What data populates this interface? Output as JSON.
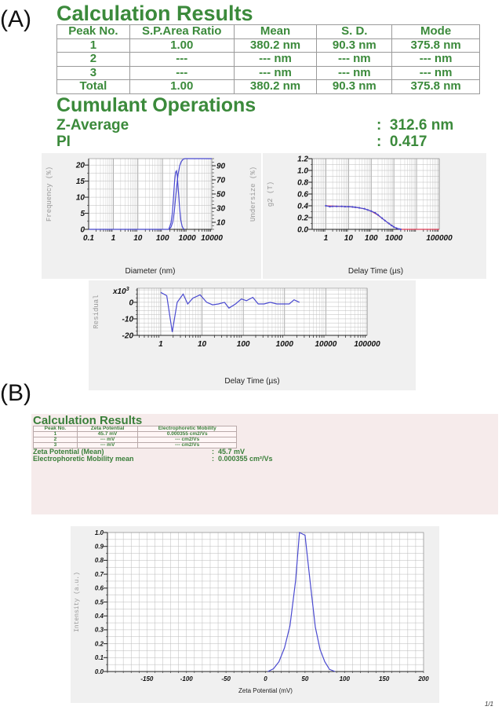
{
  "panel_a_label": "(A)",
  "panel_b_label": "(B)",
  "size_results": {
    "title": "Calculation Results",
    "headers": [
      "Peak No.",
      "S.P.Area Ratio",
      "Mean",
      "S. D.",
      "Mode"
    ],
    "rows": [
      [
        "1",
        "1.00",
        "380.2 nm",
        "90.3 nm",
        "375.8 nm"
      ],
      [
        "2",
        "---",
        "--- nm",
        "--- nm",
        "--- nm"
      ],
      [
        "3",
        "---",
        "--- nm",
        "--- nm",
        "--- nm"
      ],
      [
        "Total",
        "1.00",
        "380.2 nm",
        "90.3 nm",
        "375.8 nm"
      ]
    ],
    "cumulant_title": "Cumulant Operations",
    "z_average_label": "Z-Average",
    "z_average_value": ":  312.6 nm",
    "pi_label": "PI",
    "pi_value": ":  0.417"
  },
  "zeta_results": {
    "title": "Calculation Results",
    "headers": [
      "Peak No.",
      "Zeta Potential",
      "Electrophoretic Mobility"
    ],
    "rows": [
      [
        "1",
        "45.7 mV",
        "0.000355 cm2/Vs"
      ],
      [
        "2",
        "--- mV",
        "--- cm2/Vs"
      ],
      [
        "3",
        "--- mV",
        "--- cm2/Vs"
      ]
    ],
    "mean_label": "Zeta Potential (Mean)",
    "mean_value": ":  45.7 mV",
    "mobility_label": "Electrophoretic Mobility mean",
    "mobility_value": ":  0.000355 cm²/Vs"
  },
  "page_number": "1/1",
  "colors": {
    "green": "#3b8a3b",
    "series_blue": "#4a4ad0",
    "fit_red": "#e0405a",
    "panel_bg": "#f0f0f0",
    "pink_bg": "#f6ebeb"
  },
  "chart_data": [
    {
      "type": "line",
      "xlabel": "Diameter (nm)",
      "ylabel": "Frequency (%)",
      "y2label": "Undersize (%)",
      "xscale": "log",
      "xlim": [
        0.1,
        10000
      ],
      "ylim": [
        0,
        22
      ],
      "y2lim": [
        0,
        100
      ],
      "xticks": [
        "0.1",
        "1",
        "10",
        "100",
        "1000",
        "10000"
      ],
      "yticks": [
        "0",
        "5",
        "10",
        "15",
        "20"
      ],
      "y2ticks": [
        "10",
        "30",
        "50",
        "70",
        "90"
      ],
      "grid": true,
      "series": [
        {
          "axis": "left",
          "x": [
            180,
            220,
            250,
            280,
            310,
            340,
            370,
            400,
            440,
            490,
            550,
            620,
            700,
            800
          ],
          "y": [
            0,
            2,
            5,
            10,
            15,
            17.8,
            18.2,
            16.5,
            12,
            7,
            3,
            1,
            0.2,
            0
          ]
        },
        {
          "axis": "right",
          "x": [
            0.1,
            180,
            220,
            260,
            300,
            340,
            380,
            430,
            500,
            580,
            680,
            800,
            10000
          ],
          "y": [
            0,
            0,
            3,
            10,
            25,
            45,
            62,
            78,
            90,
            96,
            99,
            100,
            100
          ]
        }
      ]
    },
    {
      "type": "line",
      "xlabel": "Delay Time (µs)",
      "ylabel": "g2 (T)",
      "xscale": "log",
      "xlim": [
        0.25,
        100000
      ],
      "ylim": [
        0,
        1.2
      ],
      "xticks": [
        "1",
        "10",
        "100",
        "1000",
        "100000"
      ],
      "yticks": [
        "0.0",
        "0.2",
        "0.4",
        "0.6",
        "0.8",
        "1.0",
        "1.2"
      ],
      "grid": true,
      "series": [
        {
          "role": "fit",
          "x": [
            1,
            2,
            5,
            10,
            20,
            50,
            100,
            200,
            400,
            700,
            1000,
            1500,
            2000,
            5000,
            20000,
            100000
          ],
          "y": [
            0.4,
            0.395,
            0.39,
            0.385,
            0.375,
            0.35,
            0.31,
            0.24,
            0.15,
            0.08,
            0.04,
            0.01,
            0.0,
            0.0,
            0.0,
            0.0
          ]
        },
        {
          "role": "data",
          "x": [
            1,
            1.5,
            2,
            3,
            5,
            7,
            10,
            15,
            20,
            30,
            50,
            70,
            100,
            150,
            200,
            300,
            400,
            600,
            800,
            1000,
            1300,
            1700,
            2000
          ],
          "y": [
            0.4,
            0.385,
            0.39,
            0.39,
            0.39,
            0.385,
            0.385,
            0.38,
            0.375,
            0.365,
            0.35,
            0.33,
            0.31,
            0.28,
            0.245,
            0.19,
            0.15,
            0.1,
            0.065,
            0.04,
            0.02,
            0.005,
            0.0
          ]
        }
      ]
    },
    {
      "type": "line",
      "xlabel": "Delay Time (µs)",
      "ylabel": "Residual",
      "multiplier_base": "x10",
      "multiplier_exp": "3",
      "xscale": "log",
      "xlim": [
        0.27,
        100000
      ],
      "ylim": [
        -20,
        8.5
      ],
      "xticks": [
        "1",
        "10",
        "100",
        "1000",
        "10000",
        "100000"
      ],
      "yticks": [
        "-20",
        "-10",
        "0"
      ],
      "grid": true,
      "series": [
        {
          "x": [
            1,
            1.4,
            1.9,
            2.5,
            3.5,
            4.5,
            6,
            9,
            13,
            18,
            25,
            35,
            45,
            65,
            90,
            120,
            170,
            230,
            320,
            450,
            650,
            900,
            1300,
            1700,
            2300
          ],
          "y": [
            6,
            4,
            -18,
            0,
            5,
            -1,
            2.5,
            4.5,
            0,
            -1.5,
            -1,
            0,
            -3.5,
            -1,
            2,
            1,
            3,
            -1,
            -1,
            0,
            -1,
            -1,
            -1,
            1.5,
            0
          ]
        }
      ]
    },
    {
      "type": "line",
      "xlabel": "Zeta Potential (mV)",
      "ylabel": "Intensity (a.u.)",
      "xscale": "linear",
      "xlim": [
        -200,
        200
      ],
      "ylim": [
        0,
        1.0
      ],
      "xticks": [
        "-150",
        "-100",
        "-50",
        "0",
        "50",
        "100",
        "150",
        "200"
      ],
      "yticks": [
        "0.0",
        "0.1",
        "0.2",
        "0.3",
        "0.4",
        "0.5",
        "0.6",
        "0.7",
        "0.8",
        "0.9",
        "1.0"
      ],
      "grid": true,
      "series": [
        {
          "x": [
            3,
            10,
            17,
            24,
            31,
            38,
            43,
            50,
            57,
            63,
            69,
            75,
            81,
            88
          ],
          "y": [
            0,
            0.02,
            0.07,
            0.17,
            0.33,
            0.65,
            1.0,
            0.98,
            0.62,
            0.32,
            0.16,
            0.07,
            0.015,
            0
          ]
        }
      ]
    }
  ]
}
